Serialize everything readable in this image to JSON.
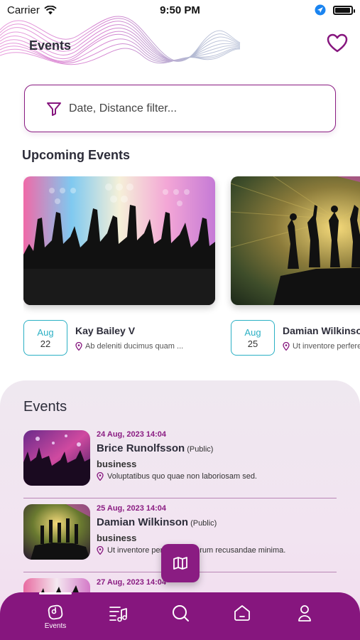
{
  "status_bar": {
    "carrier": "Carrier",
    "time": "9:50 PM"
  },
  "header": {
    "title": "Events"
  },
  "filter": {
    "placeholder": "Date, Distance filter..."
  },
  "upcoming": {
    "title": "Upcoming Events",
    "items": [
      {
        "month": "Aug",
        "day": "22",
        "name": "Kay Bailey V",
        "location": "Ab deleniti ducimus quam ..."
      },
      {
        "month": "Aug",
        "day": "25",
        "name": "Damian Wilkinson",
        "location": "Ut inventore perferendis"
      }
    ]
  },
  "events": {
    "title": "Events",
    "items": [
      {
        "datetime": "24 Aug, 2023 14:04",
        "name": "Brice Runolfsson",
        "visibility": "(Public)",
        "category": "business",
        "location": "Voluptatibus quo quae non laboriosam sed."
      },
      {
        "datetime": "25 Aug, 2023 14:04",
        "name": "Damian Wilkinson",
        "visibility": "(Public)",
        "category": "business",
        "location": "Ut inventore perferendis rerum recusandae minima."
      },
      {
        "datetime": "27 Aug, 2023 14:04",
        "name": "",
        "visibility": "",
        "category": "",
        "location": ""
      }
    ]
  },
  "nav": {
    "items": [
      {
        "label": "Events",
        "icon": "events-icon",
        "active": true
      },
      {
        "label": "",
        "icon": "music-list-icon"
      },
      {
        "label": "",
        "icon": "search-icon"
      },
      {
        "label": "",
        "icon": "home-icon"
      },
      {
        "label": "",
        "icon": "profile-icon"
      }
    ]
  },
  "colors": {
    "primary": "#86167e",
    "accent": "#2bb0c4",
    "panel": "#f1e4f0"
  }
}
